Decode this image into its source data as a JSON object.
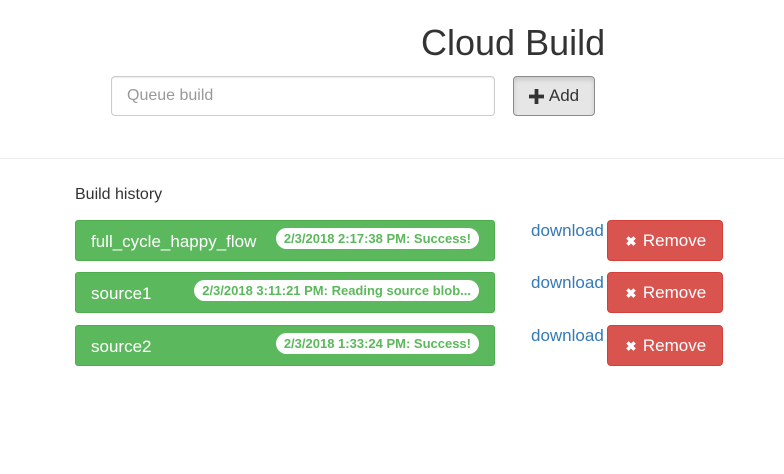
{
  "header": {
    "title": "Cloud Build"
  },
  "queue": {
    "placeholder": "Queue build",
    "value": "",
    "add_label": "Add",
    "add_icon": "plus-icon"
  },
  "history": {
    "heading": "Build history",
    "download_label": "download",
    "remove_label": "Remove",
    "remove_icon": "x-icon",
    "items": [
      {
        "name": "full_cycle_happy_flow",
        "status": "2/3/2018 2:17:38 PM: Success!"
      },
      {
        "name": "source1",
        "status": "2/3/2018 3:11:21 PM: Reading source blob..."
      },
      {
        "name": "source2",
        "status": "2/3/2018 1:33:24 PM: Success!"
      }
    ]
  },
  "colors": {
    "success": "#5cb85c",
    "danger": "#d9534f",
    "link": "#337ab7",
    "default_button": "#e6e6e6"
  }
}
